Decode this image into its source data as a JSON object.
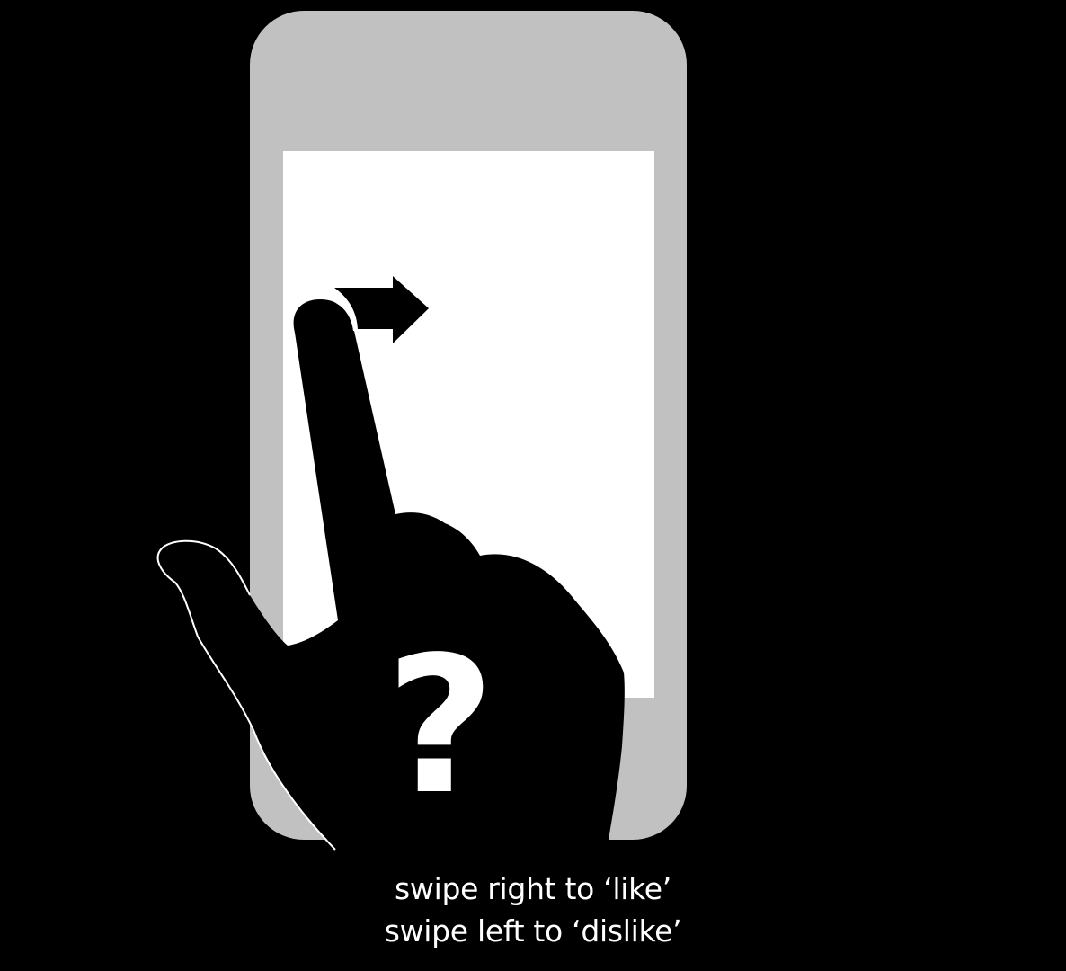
{
  "caption": {
    "line1": "swipe right to ‘like’",
    "line2": "swipe left to ‘dislike’"
  },
  "illustration": {
    "question_mark": "?",
    "phone_body_color": "#c1c1c1",
    "screen_color": "#ffffff",
    "hand_color": "#000000",
    "outline_color": "#ffffff",
    "icons": [
      "phone-icon",
      "hand-icon",
      "swipe-right-arrow-icon",
      "question-mark-icon"
    ]
  }
}
